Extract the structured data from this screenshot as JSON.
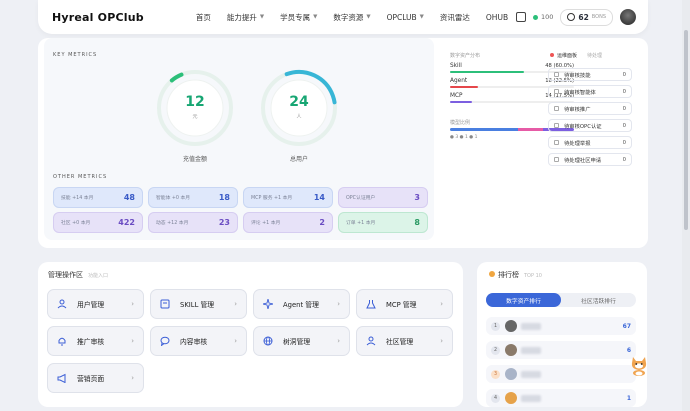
{
  "header": {
    "logo": "Hyreal OPClub",
    "nav": [
      {
        "label": "首页",
        "dropdown": false
      },
      {
        "label": "能力提升",
        "dropdown": true
      },
      {
        "label": "学员专属",
        "dropdown": true
      },
      {
        "label": "数字资源",
        "dropdown": true
      },
      {
        "label": "OPCLUB",
        "dropdown": true
      },
      {
        "label": "资讯雷达",
        "dropdown": false
      },
      {
        "label": "OHUB",
        "dropdown": false
      }
    ],
    "points": "100",
    "coins": "62",
    "coins_unit": "BONS"
  },
  "metrics": {
    "key_label": "KEY METRICS",
    "other_label": "OTHER METRICS",
    "rings": [
      {
        "value": "12",
        "unit": "元",
        "caption": "充值金额",
        "fraction": 0.05
      },
      {
        "value": "24",
        "unit": "人",
        "caption": "总用户",
        "fraction": 0.28
      }
    ],
    "tiles": [
      {
        "label": "技能 +14 本月",
        "value": "48",
        "style": "blue"
      },
      {
        "label": "智能体 +0 本月",
        "value": "18",
        "style": "blue"
      },
      {
        "label": "MCP 服务 +1 本月",
        "value": "14",
        "style": "blue"
      },
      {
        "label": "OPC认证用户",
        "value": "3",
        "style": "purple"
      },
      {
        "label": "社区 +0 本月",
        "value": "422",
        "style": "purple"
      },
      {
        "label": "动态 +12 本月",
        "value": "23",
        "style": "purple"
      },
      {
        "label": "评论 +1 本月",
        "value": "2",
        "style": "purple"
      },
      {
        "label": "订单 +1 本月",
        "value": "8",
        "style": "green"
      }
    ],
    "distribution_title": "数字资产分布",
    "distribution": [
      {
        "label": "Skill",
        "value": "48 (60.0%)",
        "fraction": 0.6,
        "color": "#2cbf7a"
      },
      {
        "label": "Agent",
        "value": "18 (22.5%)",
        "fraction": 0.225,
        "color": "#e5474b"
      },
      {
        "label": "MCP",
        "value": "14 (17.5%)",
        "fraction": 0.175,
        "color": "#7c5fe0"
      }
    ],
    "ratio_title": "模型比例",
    "ratio_legend": "● 3        ● 1        ● 1"
  },
  "todos": {
    "title": "运维面板",
    "subtitle": "待处理",
    "items": [
      {
        "label": "待审核技能",
        "count": "0"
      },
      {
        "label": "待审核智能体",
        "count": "0"
      },
      {
        "label": "待审核推广",
        "count": "0"
      },
      {
        "label": "待审核OPC认证",
        "count": "0"
      },
      {
        "label": "待处理举报",
        "count": "0"
      },
      {
        "label": "待处理社区申请",
        "count": "0"
      }
    ]
  },
  "manage": {
    "title": "管理操作区",
    "subtitle": "功能入口",
    "buttons": [
      {
        "label": "用户管理",
        "icon": "users-icon"
      },
      {
        "label": "SKILL 管理",
        "icon": "skill-icon"
      },
      {
        "label": "Agent 管理",
        "icon": "sparkle-icon"
      },
      {
        "label": "MCP 管理",
        "icon": "flask-icon"
      },
      {
        "label": "推广审核",
        "icon": "bell-icon"
      },
      {
        "label": "内容审核",
        "icon": "chat-icon"
      },
      {
        "label": "树洞管理",
        "icon": "globe-icon"
      },
      {
        "label": "社区管理",
        "icon": "community-icon"
      },
      {
        "label": "营销页面",
        "icon": "megaphone-icon"
      }
    ]
  },
  "ranking": {
    "title": "排行榜",
    "subtitle": "TOP 10",
    "tabs": [
      "数字资产排行",
      "社区活跃排行"
    ],
    "rows": [
      {
        "rank": "1",
        "value": "67"
      },
      {
        "rank": "2",
        "value": "6"
      },
      {
        "rank": "3",
        "value": ""
      },
      {
        "rank": "4",
        "value": "1"
      }
    ]
  }
}
